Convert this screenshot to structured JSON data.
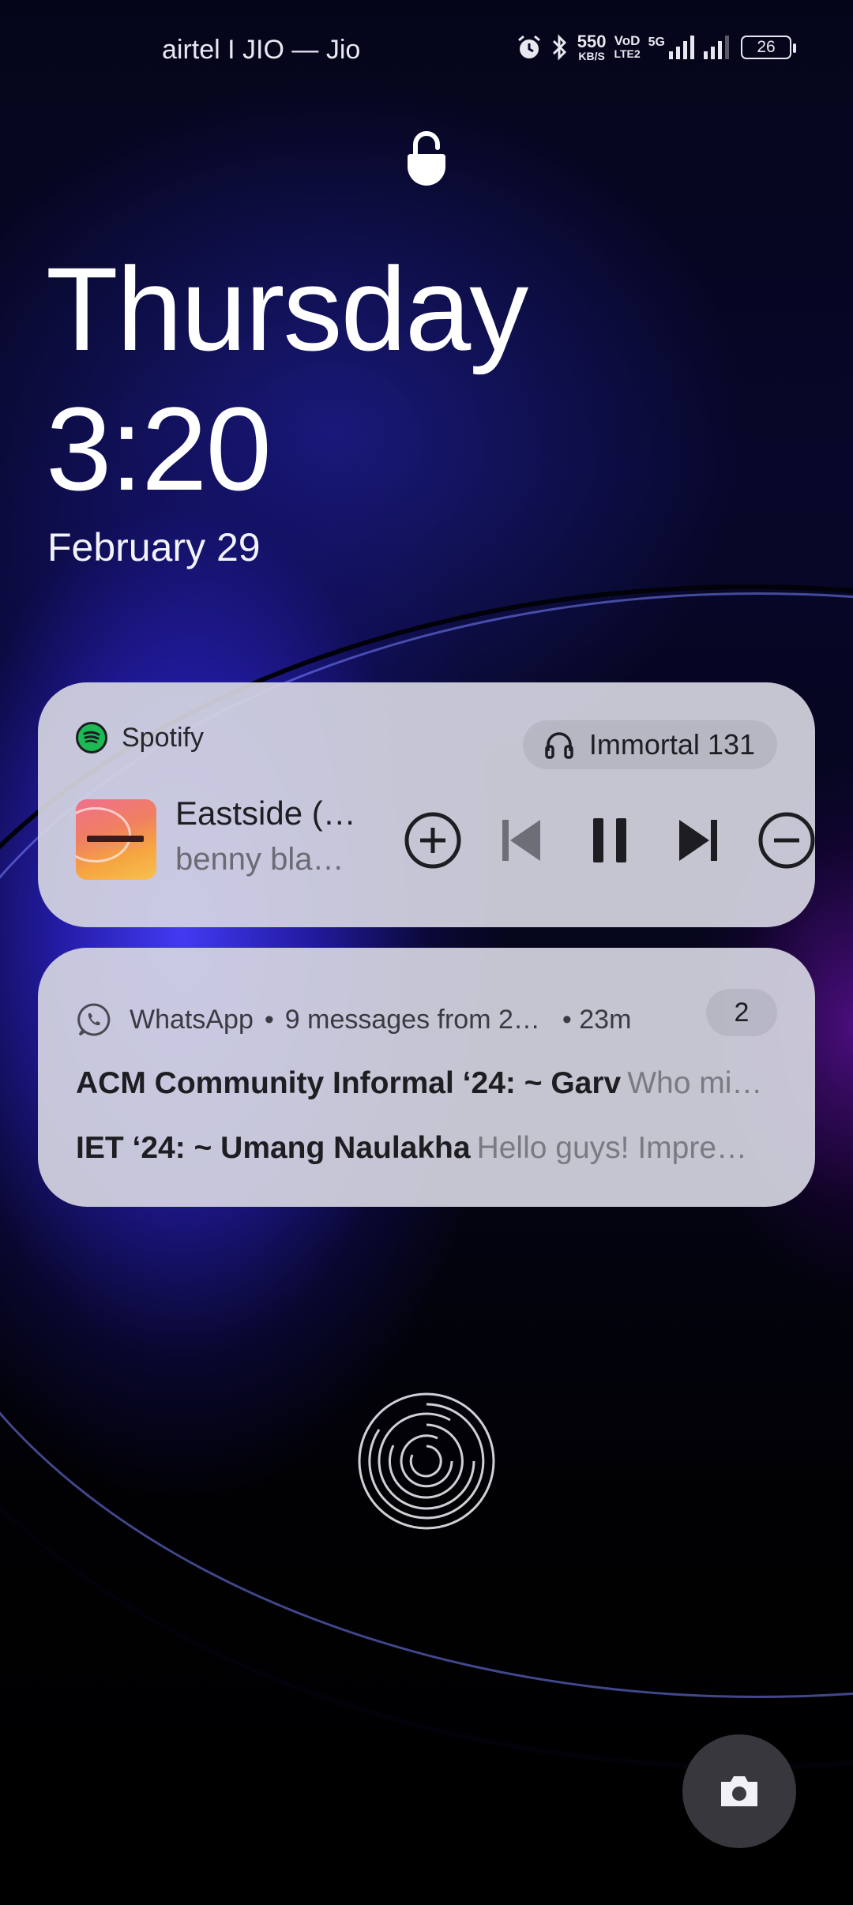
{
  "status_bar": {
    "carrier": "airtel I JIO — Jio",
    "net_speed_value": "550",
    "net_speed_unit": "KB/S",
    "volte_top": "VoD",
    "volte_bottom": "LTE2",
    "network_type": "5G",
    "battery": "26",
    "icons": [
      "alarm-icon",
      "bluetooth-icon",
      "signal-icon",
      "signal-icon"
    ]
  },
  "lock": {
    "icon": "unlocked-padlock-icon"
  },
  "clock": {
    "day": "Thursday",
    "time": "3:20",
    "date": "February 29"
  },
  "spotify": {
    "app_name": "Spotify",
    "output_device": "Immortal 131",
    "track_title": "Eastside (…",
    "track_artist": "benny bla…",
    "controls": [
      "add-icon",
      "previous-icon",
      "pause-icon",
      "next-icon",
      "remove-icon"
    ],
    "accent": "#1db954"
  },
  "whatsapp": {
    "app_name": "WhatsApp",
    "summary": "9 messages from 2…",
    "time": "23m",
    "count": "2",
    "messages": [
      {
        "sender": "ACM Community Informal ‘24: ~ Garv",
        "body": "Who mi…"
      },
      {
        "sender": "IET ‘24: ~ Umang Naulakha",
        "body": "Hello guys!  Impre…"
      }
    ]
  },
  "fingerprint": {
    "icon": "fingerprint-icon"
  },
  "camera": {
    "icon": "camera-icon"
  }
}
